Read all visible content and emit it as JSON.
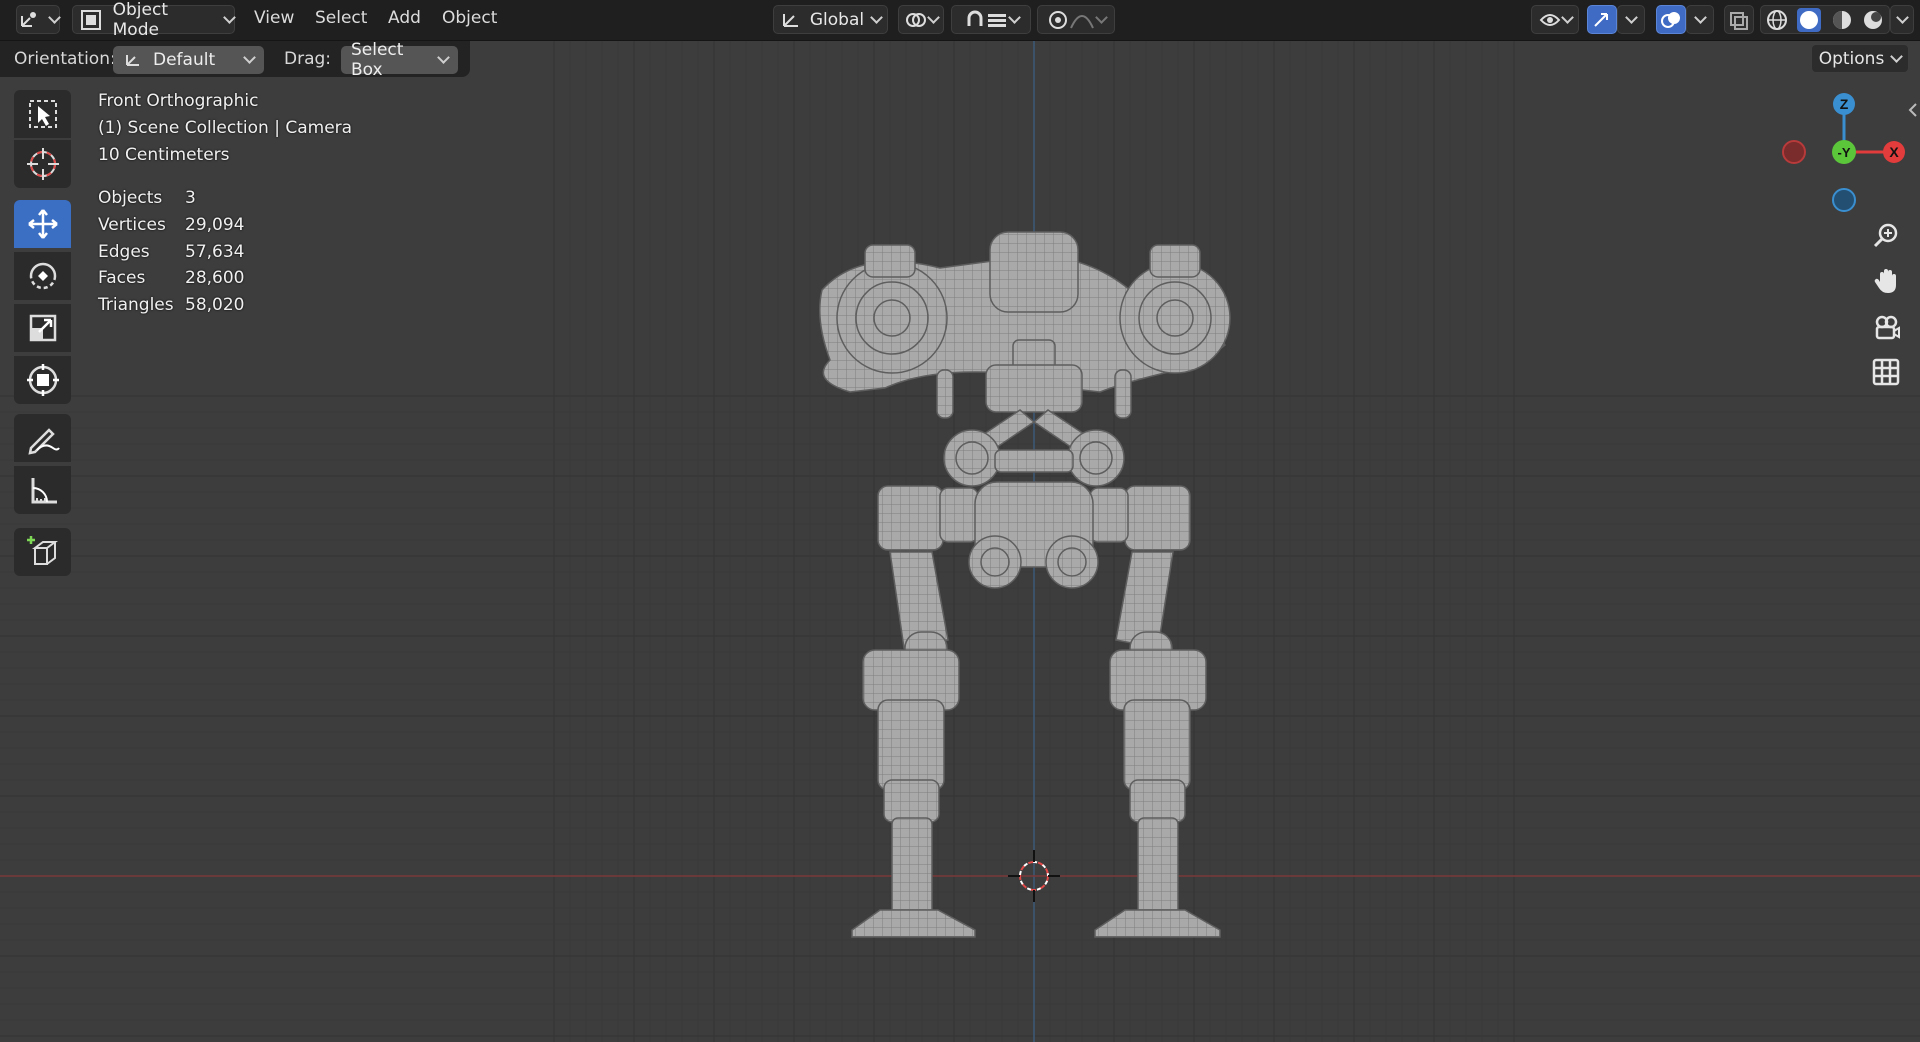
{
  "header": {
    "mode_label": "Object Mode",
    "menus": [
      "View",
      "Select",
      "Add",
      "Object"
    ],
    "orientation_global": "Global"
  },
  "tool_settings": {
    "orientation_label": "Orientation:",
    "orientation_value": "Default",
    "drag_label": "Drag:",
    "drag_value": "Select Box",
    "options_label": "Options"
  },
  "tools": [
    {
      "name": "select-box-tool-icon",
      "active": false
    },
    {
      "name": "cursor-tool-icon",
      "active": false
    },
    {
      "name": "move-tool-icon",
      "active": true
    },
    {
      "name": "rotate-tool-icon",
      "active": false
    },
    {
      "name": "scale-tool-icon",
      "active": false
    },
    {
      "name": "transform-tool-icon",
      "active": false
    },
    {
      "name": "annotate-tool-icon",
      "active": false
    },
    {
      "name": "measure-tool-icon",
      "active": false
    },
    {
      "name": "add-cube-tool-icon",
      "active": false
    }
  ],
  "viewport_info": {
    "view_name": "Front Orthographic",
    "collection": "(1) Scene Collection | Camera",
    "scale": "10 Centimeters"
  },
  "stats": [
    {
      "label": "Objects",
      "value": "3"
    },
    {
      "label": "Vertices",
      "value": "29,094"
    },
    {
      "label": "Edges",
      "value": "57,634"
    },
    {
      "label": "Faces",
      "value": "28,600"
    },
    {
      "label": "Triangles",
      "value": "58,020"
    }
  ],
  "gizmo": {
    "z_label": "Z",
    "y_label": "-Y",
    "x_label": "X",
    "colors": {
      "x": "#e23c3c",
      "y": "#5cc63b",
      "z": "#3a8fd0"
    }
  },
  "colors": {
    "accent": "#3b6fc4",
    "viewport_bg": "#3d3d3d",
    "header_bg": "#1f1f1f"
  }
}
